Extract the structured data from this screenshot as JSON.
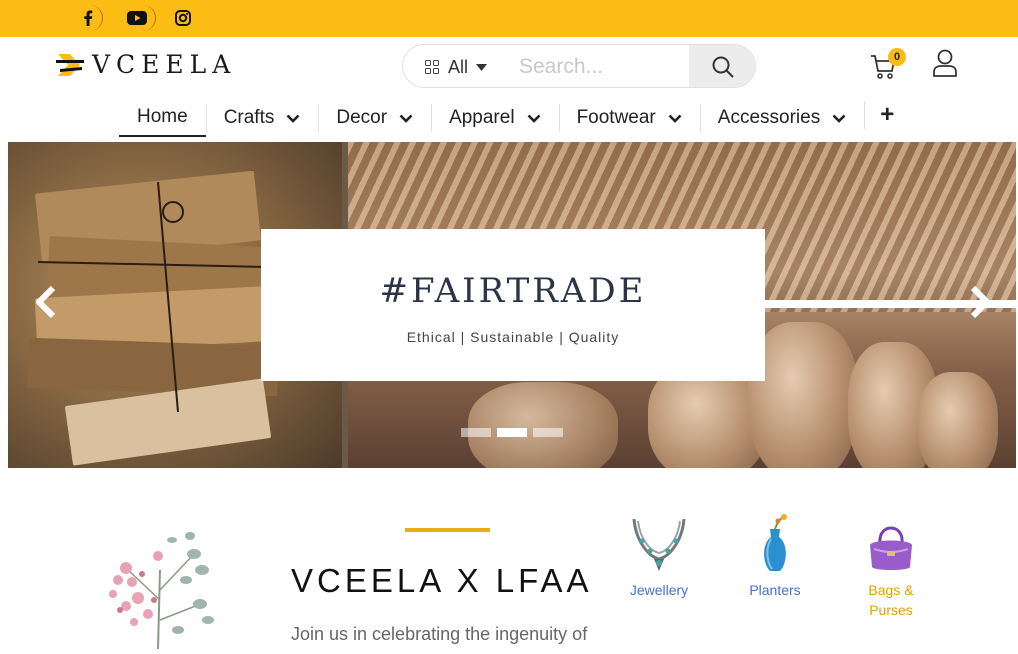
{
  "social": {
    "items": [
      {
        "name": "facebook",
        "glyph": "f"
      },
      {
        "name": "youtube",
        "glyph": "▶"
      },
      {
        "name": "instagram",
        "glyph": "◎"
      }
    ]
  },
  "header": {
    "logo_text": "VCEELA",
    "search": {
      "category_label": "All",
      "placeholder": "Search..."
    },
    "cart_count": "0"
  },
  "nav": {
    "items": [
      {
        "label": "Home",
        "has_dropdown": false
      },
      {
        "label": "Crafts",
        "has_dropdown": true
      },
      {
        "label": "Decor",
        "has_dropdown": true
      },
      {
        "label": "Apparel",
        "has_dropdown": true
      },
      {
        "label": "Footwear",
        "has_dropdown": true
      },
      {
        "label": "Accessories",
        "has_dropdown": true
      }
    ],
    "more_label": "+"
  },
  "carousel": {
    "title": "#FAIRTRADE",
    "subtitle": "Ethical | Sustainable | Quality",
    "prev_glyph": "‹",
    "next_glyph": "›",
    "active_slide": 2,
    "slide_count": 3
  },
  "promo": {
    "title": "VCEELA X LFAA",
    "text": "Join us in celebrating the ingenuity of"
  },
  "categories": [
    {
      "label": "Jewellery",
      "color": "#4a6fd0"
    },
    {
      "label": "Planters",
      "color": "#4a6fd0"
    },
    {
      "label": "Bags & Purses",
      "color": "#e0a000"
    }
  ],
  "colors": {
    "topbar": "#fbbd14",
    "accent": "#e6ae12",
    "link_blue": "#4a6fd0"
  }
}
